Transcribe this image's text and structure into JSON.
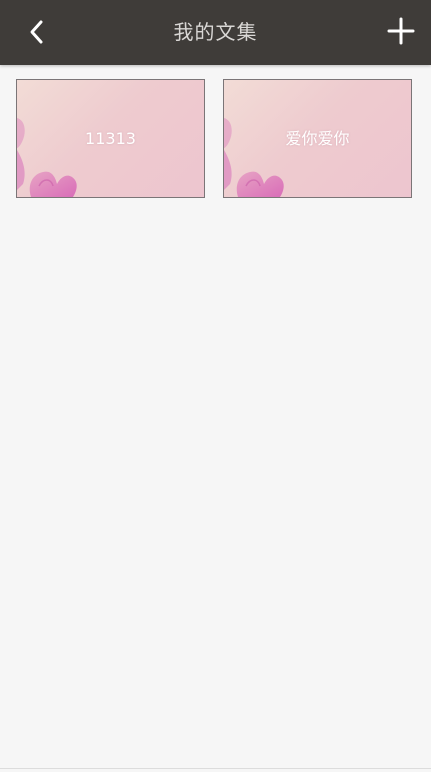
{
  "header": {
    "title": "我的文集",
    "back_icon": "chevron-left-icon",
    "add_icon": "plus-icon",
    "background_color": "#3f3c39",
    "title_color": "#d9d7d5"
  },
  "collections": [
    {
      "name": "11313"
    },
    {
      "name": "爱你爱你"
    }
  ],
  "colors": {
    "page_background": "#f6f6f6",
    "card_border": "#7b7577",
    "card_text": "#ffffff"
  }
}
